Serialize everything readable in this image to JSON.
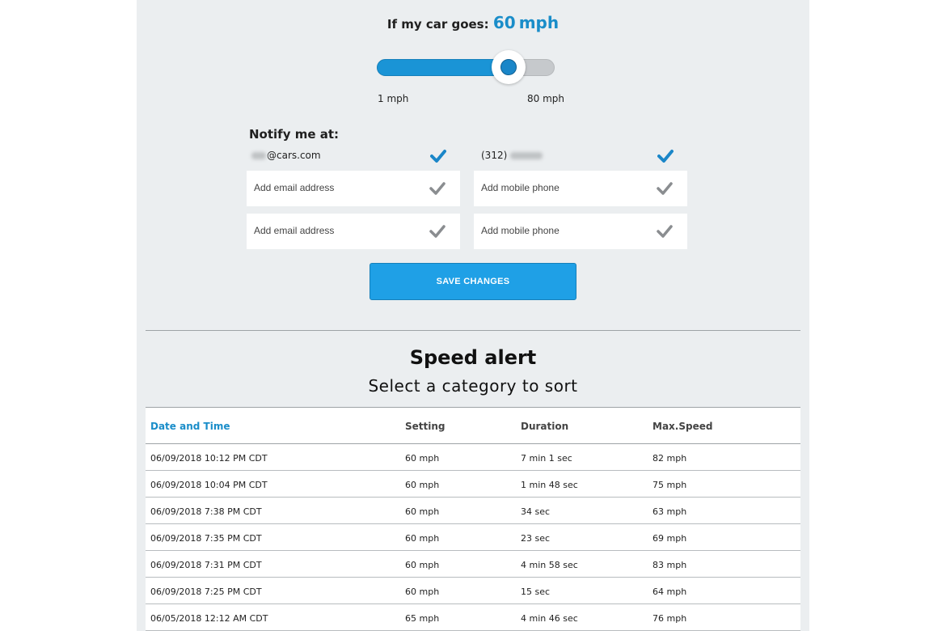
{
  "speed": {
    "prefix": "If my car goes:",
    "value": "60",
    "unit": "mph",
    "slider_min_label": "1 mph",
    "slider_max_label": "80 mph",
    "slider_fraction": 0.74
  },
  "notify": {
    "title": "Notify me at:",
    "email_current": "@cars.com",
    "phone_current": "(312)",
    "email_placeholder_1": "Add email address",
    "email_placeholder_2": "Add email address",
    "phone_placeholder_1": "Add mobile phone",
    "phone_placeholder_2": "Add mobile phone",
    "save_label": "SAVE CHANGES"
  },
  "alerts": {
    "title": "Speed alert",
    "subtitle": "Select a category to sort",
    "columns": [
      "Date and Time",
      "Setting",
      "Duration",
      "Max.Speed"
    ],
    "rows": [
      [
        "06/09/2018 10:12 PM CDT",
        "60 mph",
        "7 min 1 sec",
        "82 mph"
      ],
      [
        "06/09/2018 10:04 PM CDT",
        "60 mph",
        "1 min 48 sec",
        "75 mph"
      ],
      [
        "06/09/2018 7:38 PM CDT",
        "60 mph",
        "34 sec",
        "63 mph"
      ],
      [
        "06/09/2018 7:35 PM CDT",
        "60 mph",
        "23 sec",
        "69 mph"
      ],
      [
        "06/09/2018 7:31 PM CDT",
        "60 mph",
        "4 min 58 sec",
        "83 mph"
      ],
      [
        "06/09/2018 7:25 PM CDT",
        "60 mph",
        "15 sec",
        "64 mph"
      ],
      [
        "06/05/2018 12:12 AM CDT",
        "65 mph",
        "4 min 46 sec",
        "76 mph"
      ]
    ]
  },
  "colors": {
    "accent": "#1a8dc9",
    "button": "#1fa0e6",
    "panel_bg": "#ebeef0",
    "check_active": "#1a86c8",
    "check_inactive": "#8a8d90"
  }
}
